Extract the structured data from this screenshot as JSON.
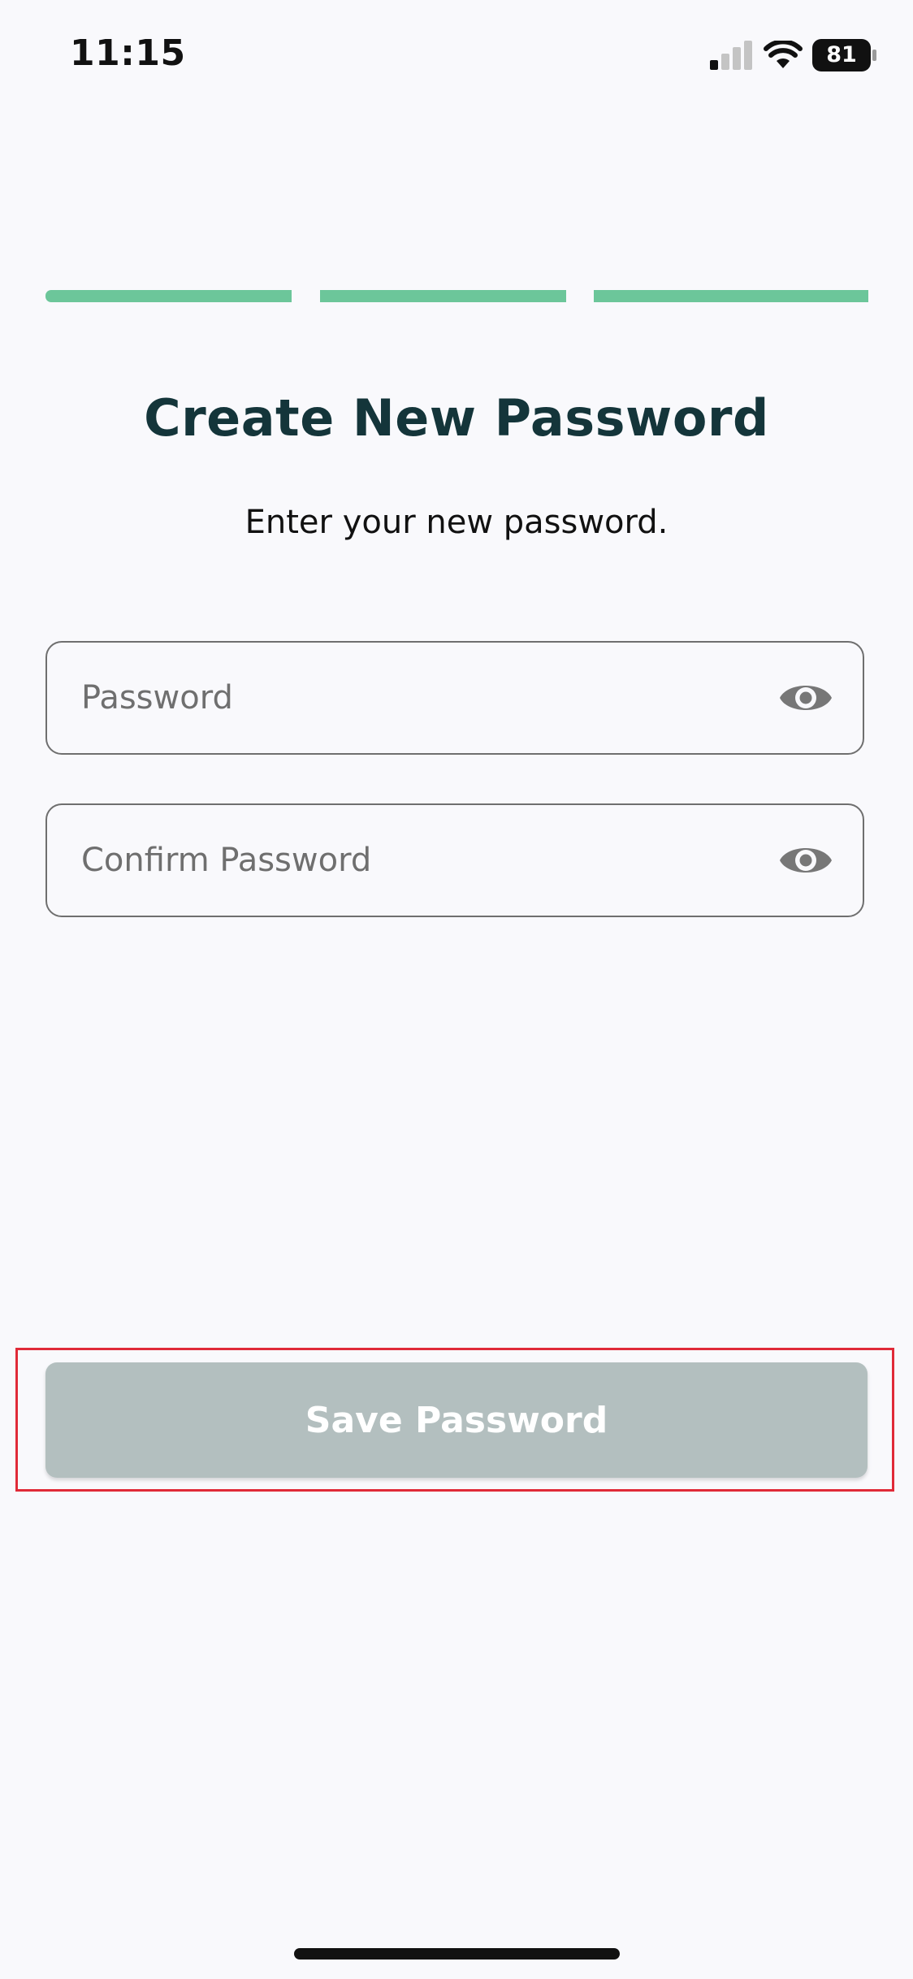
{
  "status_bar": {
    "time": "11:15",
    "battery_level": "81",
    "signal_icon": "cellular-signal-icon",
    "wifi_icon": "wifi-icon",
    "battery_icon": "battery-icon"
  },
  "progress": {
    "steps_total": 3,
    "steps_completed": 3,
    "color": "#6cc69a"
  },
  "header": {
    "title": "Create New Password",
    "subtitle": "Enter your new password."
  },
  "form": {
    "password": {
      "placeholder": "Password",
      "value": "",
      "toggle_icon": "eye-icon"
    },
    "confirm_password": {
      "placeholder": "Confirm Password",
      "value": "",
      "toggle_icon": "eye-icon"
    }
  },
  "actions": {
    "save_label": "Save Password",
    "save_state": "disabled",
    "save_color": "#b3bfbf",
    "highlight_color": "#e02a38"
  },
  "colors": {
    "title": "#14353a",
    "background": "#f9f9fc"
  }
}
